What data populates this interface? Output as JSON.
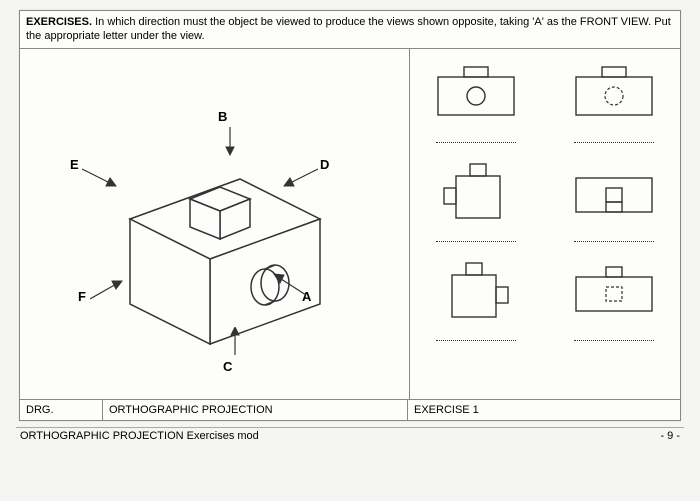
{
  "header": {
    "title": "EXERCISES.",
    "text": "In which direction must the object be viewed to produce the views shown opposite, taking 'A' as the FRONT VIEW. Put the appropriate letter under the view."
  },
  "labels": {
    "A": "A",
    "B": "B",
    "C": "C",
    "D": "D",
    "E": "E",
    "F": "F"
  },
  "titleblock": {
    "drg": "DRG.",
    "projection": "ORTHOGRAPHIC PROJECTION",
    "exercise": "EXERCISE 1"
  },
  "footer": {
    "left": "ORTHOGRAPHIC PROJECTION Exercises mod",
    "page": "- 9 -"
  }
}
